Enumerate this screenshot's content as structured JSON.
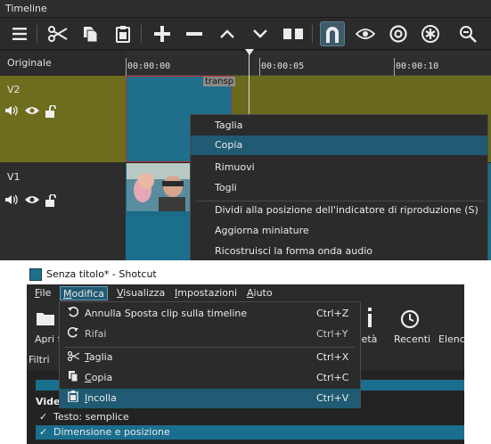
{
  "timeline": {
    "title": "Timeline",
    "toolbar_icons": [
      "menu-icon",
      "scissors-icon",
      "copy-icon",
      "paste-icon",
      "plus-icon",
      "minus-icon",
      "up-icon",
      "down-icon",
      "split-icon",
      "magnet-icon",
      "eye-icon",
      "target-icon",
      "asterisk-icon",
      "zoom-out-icon"
    ],
    "header_label": "Originale",
    "ruler": [
      "00:00:00",
      "00:00:05",
      "00:00:10"
    ],
    "tracks": [
      {
        "name": "V2"
      },
      {
        "name": "V1"
      }
    ],
    "clip_label": "transp",
    "context_menu": {
      "items": [
        "Taglia",
        "Copia",
        "Rimuovi",
        "Togli",
        "Dividi alla posizione dell'indicatore di riproduzione (S)",
        "Aggiorna miniature",
        "Ricostruisci la forma onda audio"
      ],
      "highlighted": "Copia"
    }
  },
  "shotcut": {
    "window_title": "Senza titolo* - Shotcut",
    "menubar": [
      "File",
      "Modifica",
      "Visualizza",
      "Impostazioni",
      "Aiuto"
    ],
    "active_menu": "Modifica",
    "toolbar": {
      "open_label_partial": "Apri fi",
      "properties_partial": "rietà",
      "recent_label": "Recenti",
      "list_partial": "Elenco"
    },
    "filters_label": "Filtri",
    "video_header_partial": "Vide",
    "filters": [
      {
        "label": "Testo: semplice",
        "checked": true
      },
      {
        "label": "Dimensione e posizione",
        "checked": true
      }
    ],
    "edit_menu": {
      "items": [
        {
          "icon": "undo-icon",
          "label": "Annulla Sposta clip sulla timeline",
          "shortcut": "Ctrl+Z"
        },
        {
          "icon": "redo-icon",
          "label": "Rifai",
          "shortcut": "Ctrl+Y"
        },
        {
          "icon": "cut-icon",
          "label": "Taglia",
          "shortcut": "Ctrl+X"
        },
        {
          "icon": "copy-icon",
          "label": "Copia",
          "shortcut": "Ctrl+C"
        },
        {
          "icon": "paste-icon",
          "label": "Incolla",
          "shortcut": "Ctrl+V"
        }
      ],
      "highlighted": "Incolla"
    }
  }
}
